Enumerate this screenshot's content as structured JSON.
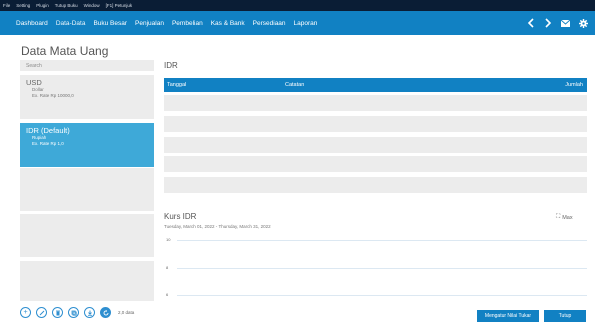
{
  "menubar": {
    "items": [
      "File",
      "Setting",
      "Plugin",
      "Tutup Buku",
      "Window",
      "[F1] Petunjuk"
    ]
  },
  "navbar": {
    "tabs": [
      "Dashboard",
      "Data-Data",
      "Buku Besar",
      "Penjualan",
      "Pembelian",
      "Kas & Bank",
      "Persediaan",
      "Laporan"
    ],
    "active_tab": "Data-Data",
    "right_icons": [
      "chevron-left-icon",
      "chevron-right-icon",
      "mail-icon",
      "gear-icon"
    ]
  },
  "page": {
    "title": "Data Mata Uang"
  },
  "search": {
    "placeholder": "Search"
  },
  "currencies": [
    {
      "code": "USD",
      "name": "Dollar",
      "rate": "Ex. Rate Rp 10000,0",
      "selected": false
    },
    {
      "code": "IDR (Default)",
      "name": "Rupiah",
      "rate": "Ex. Rate Rp 1,0",
      "selected": true
    }
  ],
  "bottom_bar": {
    "icons": [
      "add-icon",
      "edit-icon",
      "delete-icon",
      "copy-icon",
      "download-icon",
      "refresh-icon"
    ],
    "count": "2,0 data"
  },
  "detail": {
    "title": "IDR",
    "columns": [
      "Tanggal",
      "Catatan",
      "Jumlah"
    ]
  },
  "kurs": {
    "title": "Kurs IDR",
    "range": "Tuesday, March 01, 2022 - Thursday, March 31, 2022",
    "max_label": "Max",
    "ticks": [
      "10",
      "8",
      "6"
    ]
  },
  "buttons": {
    "adjust": "Mengatur Nilai Tukar",
    "close": "Tutup"
  },
  "colors": {
    "accent": "#1181c3",
    "menubar": "#0a1d35",
    "selected": "#3ea9d8",
    "panel": "#ececec"
  }
}
